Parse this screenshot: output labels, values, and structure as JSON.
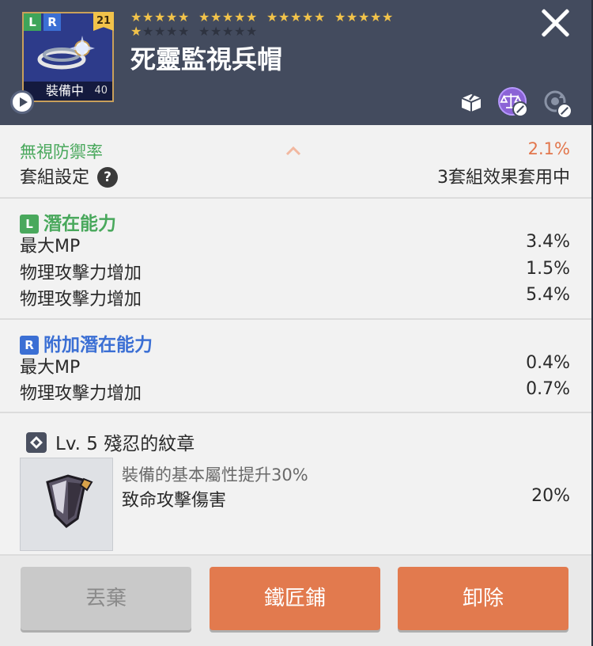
{
  "item": {
    "name": "死靈監視兵帽",
    "badge_left": "L",
    "badge_right": "R",
    "level": "21",
    "equipped_label": "裝備中",
    "star_count": "40",
    "stars_filled": 21,
    "stars_total": 30
  },
  "header": {
    "share_icon": "share-icon",
    "scale_icon": "scale-icon",
    "reset_icon": "reset-icon"
  },
  "stats": {
    "ignore_defense_label": "無視防禦率",
    "ignore_defense_value": "2.1%",
    "set_label": "套組設定",
    "set_help": "?",
    "set_value": "3套組效果套用中"
  },
  "potential": {
    "tag": "L",
    "title": "潛在能力",
    "lines": [
      {
        "label": "最大MP",
        "value": "3.4%"
      },
      {
        "label": "物理攻擊力增加",
        "value": "1.5%"
      },
      {
        "label": "物理攻擊力增加",
        "value": "5.4%"
      }
    ]
  },
  "additional_potential": {
    "tag": "R",
    "title": "附加潛在能力",
    "lines": [
      {
        "label": "最大MP",
        "value": "0.4%"
      },
      {
        "label": "物理攻擊力增加",
        "value": "0.7%"
      }
    ]
  },
  "emblem": {
    "title": "Lv. 5 殘忍的紋章",
    "desc": "裝備的基本屬性提升30%",
    "effect_label": "致命攻擊傷害",
    "effect_value": "20%"
  },
  "buttons": {
    "discard": "丟棄",
    "smith": "鐵匠鋪",
    "unequip": "卸除"
  },
  "colors": {
    "header_bg": "#434b5e",
    "accent_orange": "#e27a4e",
    "green": "#49a85c",
    "blue": "#3b6fd4"
  }
}
